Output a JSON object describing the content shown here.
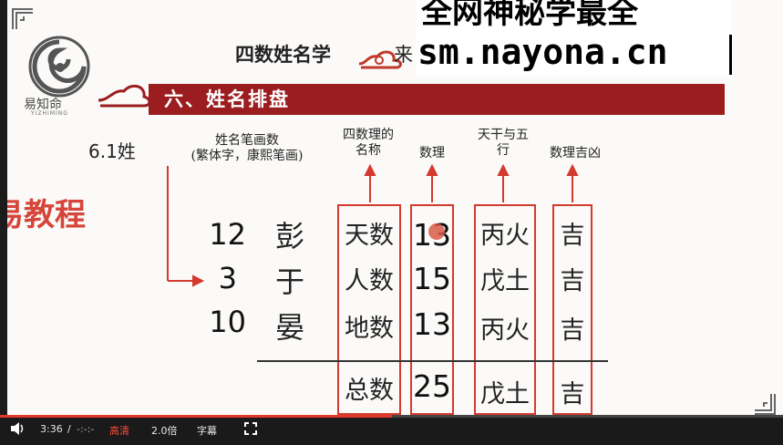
{
  "overlay": {
    "line1": "全网神秘学最全",
    "line2": "sm.nayona.cn"
  },
  "brand": {
    "name": "易知命",
    "sub": "YIZHIMING"
  },
  "slide": {
    "title": "四数姓名学",
    "title_tail": "来",
    "banner": "六、姓名排盘",
    "section": "6.1姓",
    "watermark": "易教程"
  },
  "labels": {
    "strokes": "姓名笔画数",
    "strokes_note": "(繁体字，康熙笔画)",
    "four_names": "四数理的名称",
    "number": "数理",
    "stems": "天干与五行",
    "luck": "数理吉凶"
  },
  "rows": [
    {
      "strokes": "12",
      "char": "彭",
      "name": "天数",
      "value": "13",
      "stem": "丙火",
      "luck": "吉"
    },
    {
      "strokes": "3",
      "char": "于",
      "name": "人数",
      "value": "15",
      "stem": "戊土",
      "luck": "吉"
    },
    {
      "strokes": "10",
      "char": "晏",
      "name": "地数",
      "value": "13",
      "stem": "丙火",
      "luck": "吉"
    }
  ],
  "total": {
    "name": "总数",
    "value": "25",
    "stem": "戊土",
    "luck": "吉"
  },
  "player": {
    "time": "3:36",
    "separator": "/",
    "duration": "-:-:-",
    "quality": "高清",
    "speed": "2.0倍",
    "subtitles": "字幕",
    "progress_fraction": 0.5,
    "accent": "#e23b2e"
  }
}
